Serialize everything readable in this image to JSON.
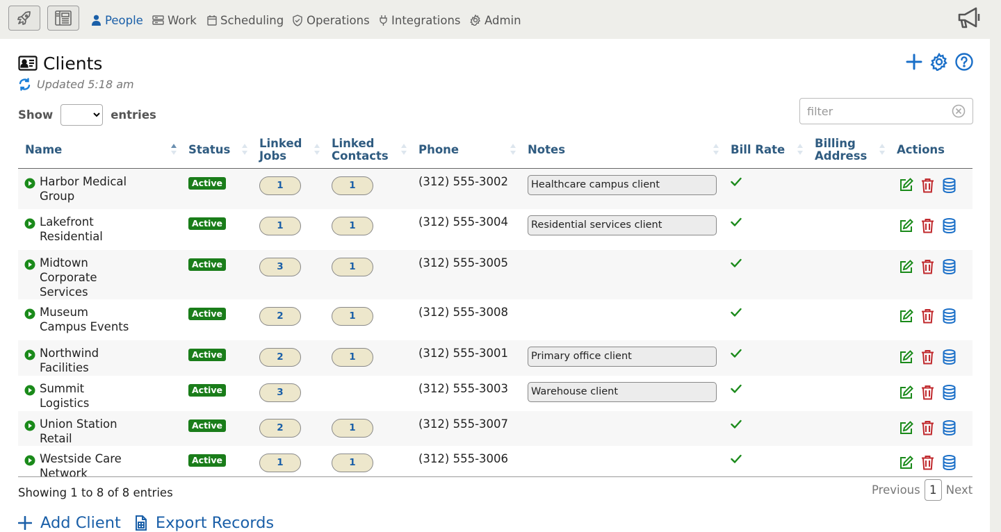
{
  "nav": {
    "items": [
      {
        "label": "People",
        "icon": "person-icon",
        "active": true
      },
      {
        "label": "Work",
        "icon": "work-icon"
      },
      {
        "label": "Scheduling",
        "icon": "calendar-icon"
      },
      {
        "label": "Operations",
        "icon": "shield-icon"
      },
      {
        "label": "Integrations",
        "icon": "plug-icon"
      },
      {
        "label": "Admin",
        "icon": "gear-icon"
      }
    ]
  },
  "page": {
    "title": "Clients",
    "updated": "Updated 5:18 am"
  },
  "controls": {
    "show_label": "Show",
    "entries_label": "entries",
    "filter_placeholder": "filter"
  },
  "table": {
    "columns": [
      "Name",
      "Status",
      "Linked Jobs",
      "Linked Contacts",
      "Phone",
      "Notes",
      "Bill Rate",
      "Billing Address",
      "Actions"
    ],
    "rows": [
      {
        "name": "Harbor Medical Group",
        "status": "Active",
        "jobs": "1",
        "contacts": "1",
        "phone": "(312) 555-3002",
        "notes": "Healthcare campus client",
        "bill_rate": true
      },
      {
        "name": "Lakefront Residential",
        "status": "Active",
        "jobs": "1",
        "contacts": "1",
        "phone": "(312) 555-3004",
        "notes": "Residential services client",
        "bill_rate": true
      },
      {
        "name": "Midtown Corporate Services",
        "status": "Active",
        "jobs": "3",
        "contacts": "1",
        "phone": "(312) 555-3005",
        "notes": "",
        "bill_rate": true
      },
      {
        "name": "Museum Campus Events",
        "status": "Active",
        "jobs": "2",
        "contacts": "1",
        "phone": "(312) 555-3008",
        "notes": "",
        "bill_rate": true
      },
      {
        "name": "Northwind Facilities",
        "status": "Active",
        "jobs": "2",
        "contacts": "1",
        "phone": "(312) 555-3001",
        "notes": "Primary office client",
        "bill_rate": true
      },
      {
        "name": "Summit Logistics",
        "status": "Active",
        "jobs": "3",
        "contacts": "",
        "phone": "(312) 555-3003",
        "notes": "Warehouse client",
        "bill_rate": true
      },
      {
        "name": "Union Station Retail",
        "status": "Active",
        "jobs": "2",
        "contacts": "1",
        "phone": "(312) 555-3007",
        "notes": "",
        "bill_rate": true
      },
      {
        "name": "Westside Care Network",
        "status": "Active",
        "jobs": "1",
        "contacts": "1",
        "phone": "(312) 555-3006",
        "notes": "",
        "bill_rate": true
      }
    ]
  },
  "footer": {
    "showing": "Showing 1 to 8 of 8 entries",
    "previous": "Previous",
    "page": "1",
    "next": "Next",
    "add_client": "Add Client",
    "export_records": "Export Records"
  },
  "colors": {
    "accent": "#1a5fa8",
    "active_badge": "#1a7d1a",
    "delete": "#c0282c",
    "edit": "#1a8a1a"
  }
}
